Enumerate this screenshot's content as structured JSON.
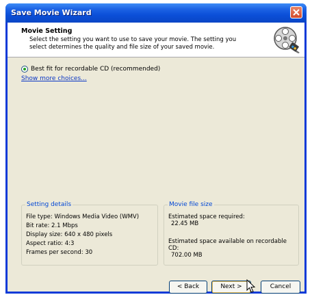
{
  "window": {
    "title": "Save Movie Wizard"
  },
  "header": {
    "title": "Movie Setting",
    "description": "Select the setting you want to use to save your movie. The setting you select determines the quality and file size of your saved movie."
  },
  "options": {
    "selected_option": "Best fit for recordable CD (recommended)",
    "more_choices_link": "Show more choices..."
  },
  "setting_details": {
    "title": "Setting details",
    "lines": [
      "File type: Windows Media Video (WMV)",
      "Bit rate: 2.1 Mbps",
      "Display size: 640 x 480 pixels",
      "Aspect ratio: 4:3",
      "Frames per second: 30"
    ]
  },
  "movie_file_size": {
    "title": "Movie file size",
    "required_label": "Estimated space required:",
    "required_value": "22.45 MB",
    "available_label": "Estimated space available on recordable CD:",
    "available_value": "702.00 MB"
  },
  "buttons": {
    "back": "< Back",
    "next": "Next >",
    "cancel": "Cancel"
  },
  "colors": {
    "titlebar": "#0b4fd8",
    "dialog_bg": "#ece9d8",
    "group_title": "#0046d5",
    "link": "#0b37c5"
  }
}
